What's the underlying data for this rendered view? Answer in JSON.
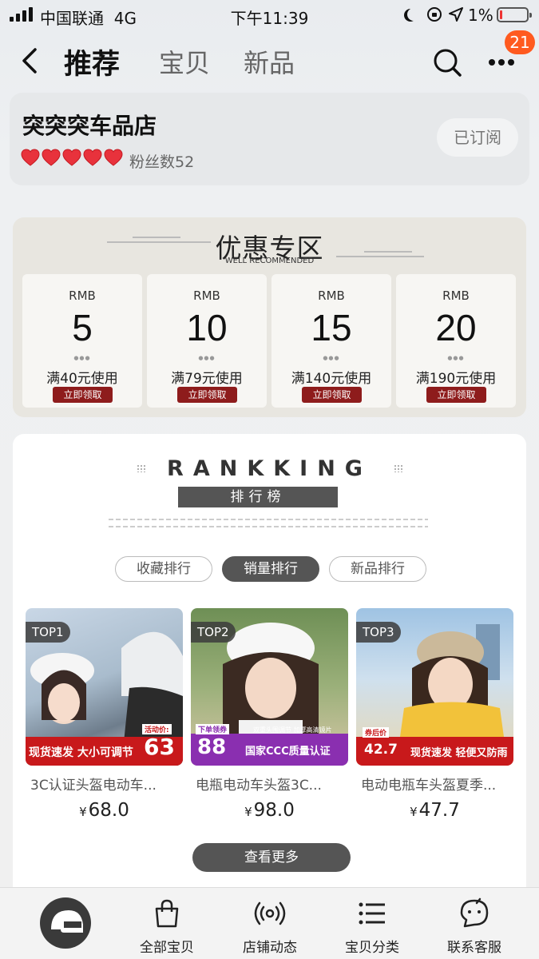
{
  "status_bar": {
    "carrier": "中国联通",
    "network": "4G",
    "time": "下午11:39",
    "battery": "1%"
  },
  "nav": {
    "tabs": [
      {
        "label": "推荐",
        "active": true
      },
      {
        "label": "宝贝",
        "active": false
      },
      {
        "label": "新品",
        "active": false
      }
    ],
    "message_count": "21",
    "icons": [
      "back-arrow-icon",
      "search-icon",
      "more-dots-icon"
    ]
  },
  "shop": {
    "name": "突突突车品店",
    "hearts": 5,
    "fans": "粉丝数52",
    "subscribe_label": "已订阅"
  },
  "coupons": {
    "title": "优惠专区",
    "subtitle": "WELL RECOMMENDED",
    "items": [
      {
        "currency": "RMB",
        "amount": "5",
        "condition": "满40元使用",
        "action": "立即领取"
      },
      {
        "currency": "RMB",
        "amount": "10",
        "condition": "满79元使用",
        "action": "立即领取"
      },
      {
        "currency": "RMB",
        "amount": "15",
        "condition": "满140元使用",
        "action": "立即领取"
      },
      {
        "currency": "RMB",
        "amount": "20",
        "condition": "满190元使用",
        "action": "立即领取"
      }
    ]
  },
  "ranking": {
    "title": "RANKKING",
    "subtitle": "排行榜",
    "tabs": [
      {
        "label": "收藏排行",
        "active": false
      },
      {
        "label": "销量排行",
        "active": true
      },
      {
        "label": "新品排行",
        "active": false
      }
    ],
    "products": [
      {
        "rank": "TOP1",
        "promo": "现货速发 大小可调节",
        "promo_price": "63",
        "promo_price_label": "活动价:",
        "name": "3C认证头盔电动车...",
        "currency": "¥",
        "price": "68.0"
      },
      {
        "rank": "TOP2",
        "promo": "国家CCC质量认证",
        "promo_price": "88",
        "promo_price_label": "下单领券",
        "promo_note": "双重头围调节 加厚高清镜片",
        "name": "电瓶电动车头盔3C...",
        "currency": "¥",
        "price": "98.0"
      },
      {
        "rank": "TOP3",
        "promo": "现货速发 轻便又防雨",
        "promo_price": "42.7",
        "promo_price_label": "券后价",
        "name": "电动电瓶车头盔夏季...",
        "currency": "¥",
        "price": "47.7"
      }
    ],
    "see_more": "查看更多"
  },
  "tabbar": {
    "items": [
      {
        "label": "全部宝贝",
        "icon": "shopping-bag-icon"
      },
      {
        "label": "店铺动态",
        "icon": "broadcast-icon"
      },
      {
        "label": "宝贝分类",
        "icon": "list-icon"
      },
      {
        "label": "联系客服",
        "icon": "chat-face-icon"
      }
    ],
    "logo_icon": "helmet-logo-icon"
  },
  "colors": {
    "accent": "#ff5a1f",
    "coupon_button": "#8e1c1c",
    "promo_red": "#c8191b",
    "dark_button": "#555555"
  }
}
